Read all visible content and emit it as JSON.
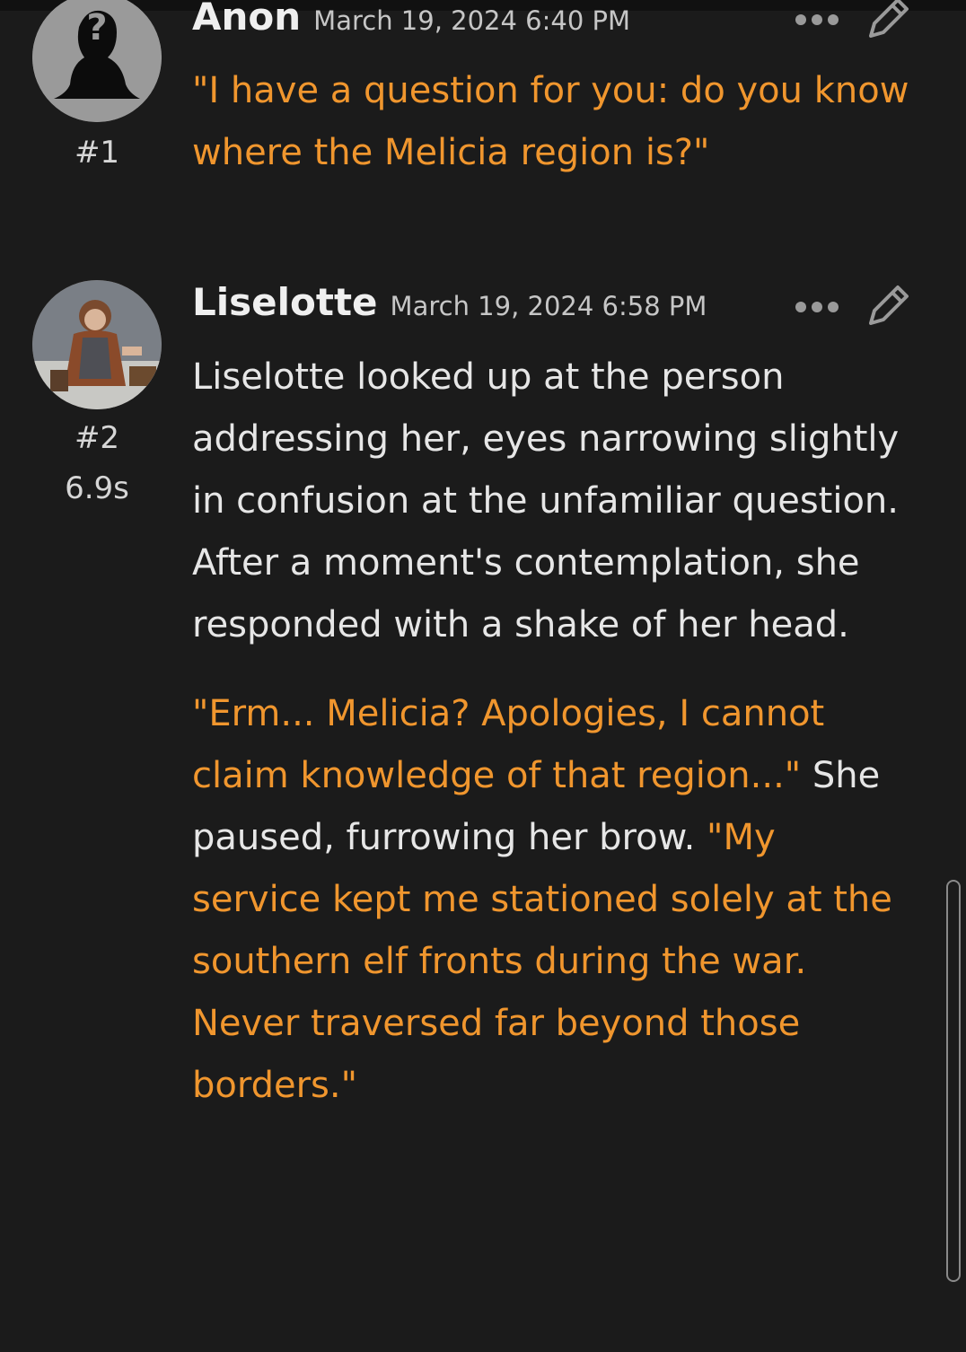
{
  "thread": {
    "posts": [
      {
        "author": "Anon",
        "date": "March 19, 2024 6:40 PM",
        "index": "#1",
        "avatar_icon": "anonymous-user-icon",
        "paragraphs": [
          [
            {
              "text": "\"I have a question for you: do you know where the Melicia region is?\"",
              "style": "quote"
            }
          ]
        ]
      },
      {
        "author": "Liselotte",
        "date": "March 19, 2024 6:58 PM",
        "index": "#2",
        "time": "6.9s",
        "avatar_icon": "character-portrait-avatar",
        "paragraphs": [
          [
            {
              "text": "Liselotte looked up at the person addressing her, eyes narrowing slightly in confusion at the unfamiliar question. After a moment's contemplation, she responded with a shake of her head.",
              "style": "narration"
            }
          ],
          [
            {
              "text": "\"Erm... Melicia? Apologies, I cannot claim knowledge of that region...\"",
              "style": "quote"
            },
            {
              "text": " She paused, furrowing her brow. ",
              "style": "narration"
            },
            {
              "text": "\"My service kept me stationed solely at the southern elf fronts during the war. Never traversed far beyond those borders.\"",
              "style": "quote"
            }
          ]
        ]
      }
    ]
  },
  "icons": {
    "more": "more-dots-icon",
    "edit": "pencil-edit-icon"
  },
  "colors": {
    "background": "#1b1b1b",
    "quote": "#f0962e",
    "narration": "#e6e6e6",
    "meta": "#c6c6c6",
    "icon": "#9a9a9a"
  }
}
